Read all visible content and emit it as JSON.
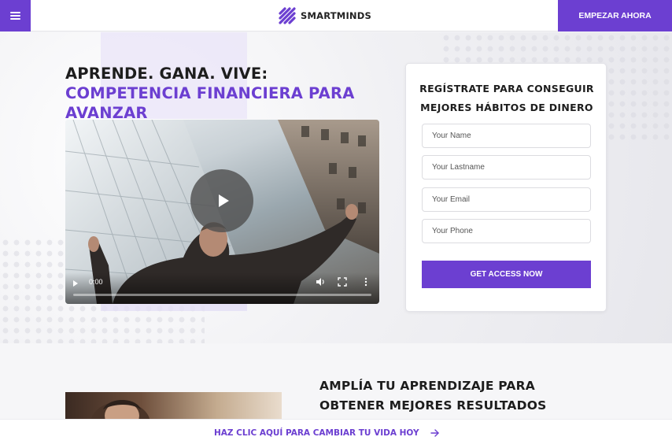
{
  "header": {
    "brand": "SMARTMINDS",
    "cta_label": "EMPEZAR AHORA",
    "icons": {
      "menu": "hamburger-menu-icon",
      "logo": "smartminds-logo-icon"
    }
  },
  "hero": {
    "title_plain": "APRENDE. GANA. VIVE: ",
    "title_accent": "COMPETENCIA FINANCIERA PARA AVANZAR",
    "video": {
      "time": "0:00",
      "progress": 0,
      "icons": [
        "play-icon",
        "volume-icon",
        "fullscreen-icon",
        "more-options-icon"
      ]
    }
  },
  "form": {
    "title": "REGÍSTRATE PARA CONSEGUIR MEJORES HÁBITOS DE DINERO",
    "fields": [
      {
        "placeholder": "Your Name",
        "value": ""
      },
      {
        "placeholder": "Your Lastname",
        "value": ""
      },
      {
        "placeholder": "Your Email",
        "value": ""
      },
      {
        "placeholder": "Your Phone",
        "value": ""
      }
    ],
    "submit_label": "GET ACCESS NOW"
  },
  "section2": {
    "title": "AMPLÍA TU APRENDIZAJE PARA OBTENER MEJORES RESULTADOS"
  },
  "sticky": {
    "link_text": "HAZ CLIC AQUÍ PARA CAMBIAR TU VIDA HOY",
    "icon": "arrow-right-icon"
  },
  "colors": {
    "accent": "#6c3fd1",
    "text": "#1d1d1d",
    "background": "#f4f4f6"
  }
}
